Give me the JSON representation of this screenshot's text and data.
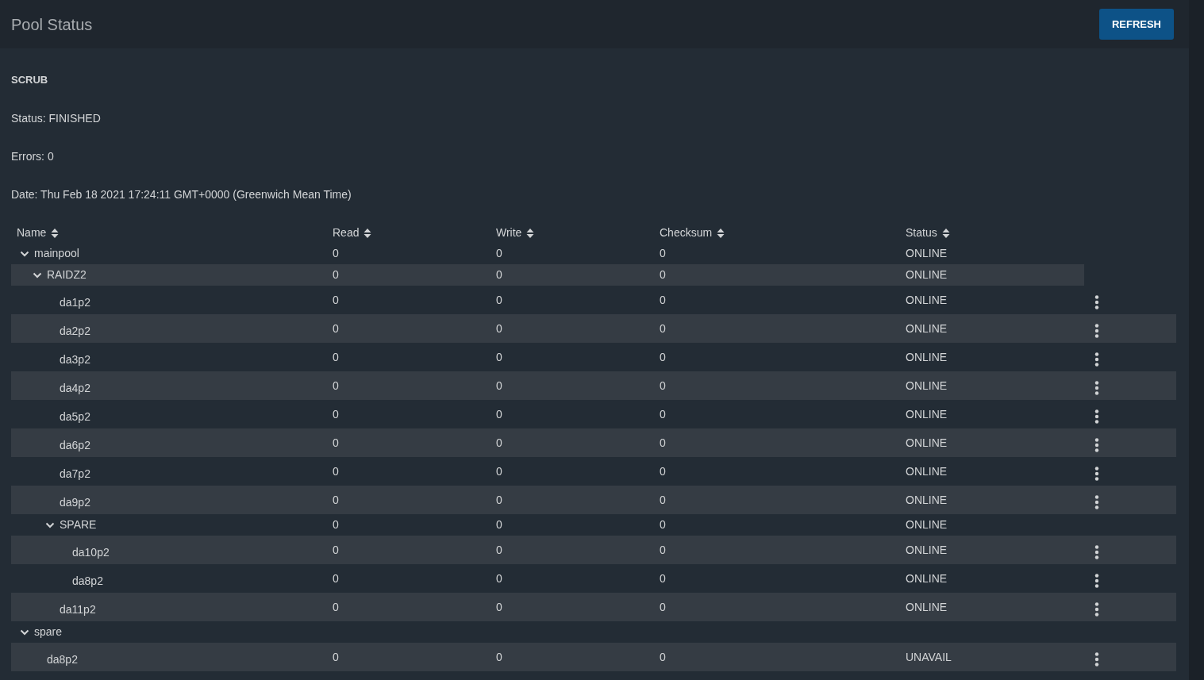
{
  "header": {
    "title": "Pool Status",
    "refresh_button": "REFRESH"
  },
  "scrub": {
    "heading": "SCRUB",
    "status": "Status: FINISHED",
    "errors": "Errors: 0",
    "date": "Date: Thu Feb 18 2021 17:24:11 GMT+0000 (Greenwich Mean Time)"
  },
  "table": {
    "columns": [
      "Name",
      "Read",
      "Write",
      "Checksum",
      "Status"
    ],
    "rows": [
      {
        "name": "mainpool",
        "read": "0",
        "write": "0",
        "checksum": "0",
        "status": "ONLINE",
        "expanded": true,
        "children": [
          {
            "name": "RAIDZ2",
            "read": "0",
            "write": "0",
            "checksum": "0",
            "status": "ONLINE",
            "expanded": true,
            "children": [
              {
                "name": "da1p2",
                "read": "0",
                "write": "0",
                "checksum": "0",
                "status": "ONLINE"
              },
              {
                "name": "da2p2",
                "read": "0",
                "write": "0",
                "checksum": "0",
                "status": "ONLINE"
              },
              {
                "name": "da3p2",
                "read": "0",
                "write": "0",
                "checksum": "0",
                "status": "ONLINE"
              },
              {
                "name": "da4p2",
                "read": "0",
                "write": "0",
                "checksum": "0",
                "status": "ONLINE"
              },
              {
                "name": "da5p2",
                "read": "0",
                "write": "0",
                "checksum": "0",
                "status": "ONLINE"
              },
              {
                "name": "da6p2",
                "read": "0",
                "write": "0",
                "checksum": "0",
                "status": "ONLINE"
              },
              {
                "name": "da7p2",
                "read": "0",
                "write": "0",
                "checksum": "0",
                "status": "ONLINE"
              },
              {
                "name": "da9p2",
                "read": "0",
                "write": "0",
                "checksum": "0",
                "status": "ONLINE"
              },
              {
                "name": "SPARE",
                "read": "0",
                "write": "0",
                "checksum": "0",
                "status": "ONLINE",
                "expanded": true,
                "children": [
                  {
                    "name": "da10p2",
                    "read": "0",
                    "write": "0",
                    "checksum": "0",
                    "status": "ONLINE"
                  },
                  {
                    "name": "da8p2",
                    "read": "0",
                    "write": "0",
                    "checksum": "0",
                    "status": "ONLINE"
                  }
                ]
              },
              {
                "name": "da11p2",
                "read": "0",
                "write": "0",
                "checksum": "0",
                "status": "ONLINE"
              }
            ]
          }
        ]
      },
      {
        "name": "spare",
        "expanded": true,
        "children": [
          {
            "name": "da8p2",
            "read": "0",
            "write": "0",
            "checksum": "0",
            "status": "UNAVAIL"
          }
        ]
      }
    ]
  }
}
